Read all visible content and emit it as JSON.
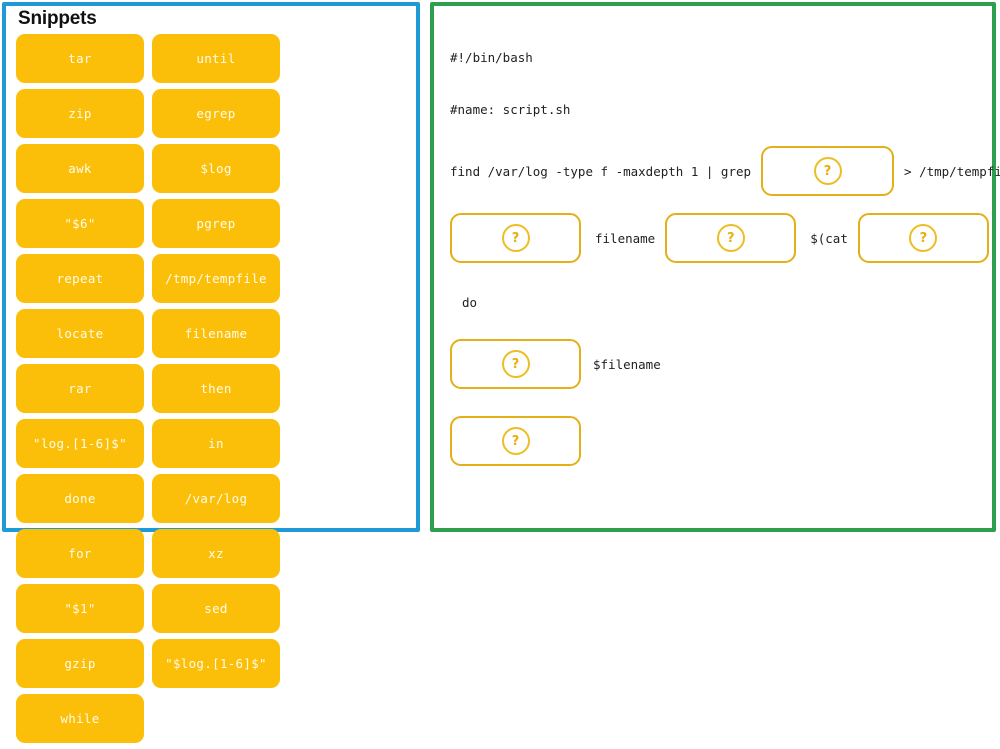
{
  "theme": {
    "snippet_panel_border": "#1e9ad6",
    "script_panel_border": "#2e9e4f",
    "tile_bg": "#fbbf09",
    "tile_text": "#fffbe8",
    "dropzone_border": "#e3b019",
    "qmark_color": "#e8ae12",
    "code_text": "#222222",
    "page_bg": "#ffffff"
  },
  "snippets": {
    "title": "Snippets",
    "tiles": [
      {
        "label": "tar"
      },
      {
        "label": "until"
      },
      {
        "label": "zip"
      },
      {
        "label": "egrep"
      },
      {
        "label": "awk"
      },
      {
        "label": "$log"
      },
      {
        "label": "\"$6\""
      },
      {
        "label": "pgrep"
      },
      {
        "label": "repeat"
      },
      {
        "label": "/tmp/tempfile"
      },
      {
        "label": "locate"
      },
      {
        "label": "filename"
      },
      {
        "label": "rar"
      },
      {
        "label": "then"
      },
      {
        "label": "\"log.[1-6]$\""
      },
      {
        "label": "in"
      },
      {
        "label": "done"
      },
      {
        "label": "/var/log"
      },
      {
        "label": "for"
      },
      {
        "label": "xz"
      },
      {
        "label": "\"$1\""
      },
      {
        "label": "sed"
      },
      {
        "label": "gzip"
      },
      {
        "label": "\"$log.[1-6]$\""
      },
      {
        "label": "while"
      }
    ]
  },
  "script": {
    "dropzone_placeholder": "?",
    "lines": {
      "shebang": "#!/bin/bash",
      "name_comment": "#name: script.sh",
      "find_prefix": "find /var/log -type f -maxdepth 1 | grep",
      "find_suffix": "> /tmp/tempfile",
      "for_mid": "filename",
      "for_cat": "$(cat",
      "for_close": ")",
      "do_keyword": "do",
      "mv_arg": "$filename"
    }
  }
}
